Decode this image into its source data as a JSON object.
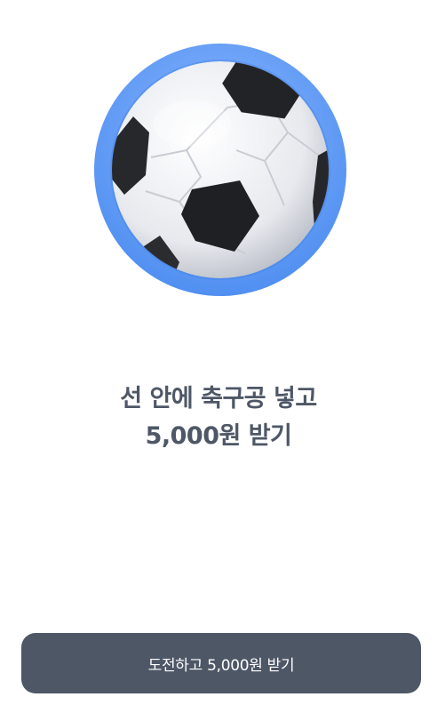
{
  "hero": {
    "icon": "soccer-ball-icon",
    "ring_color": "#5a96f2"
  },
  "headline": {
    "line1": "선 안에 축구공 넣고",
    "line2": "5,000원 받기"
  },
  "cta": {
    "label": "도전하고 5,000원 받기",
    "background": "#4e5766"
  }
}
